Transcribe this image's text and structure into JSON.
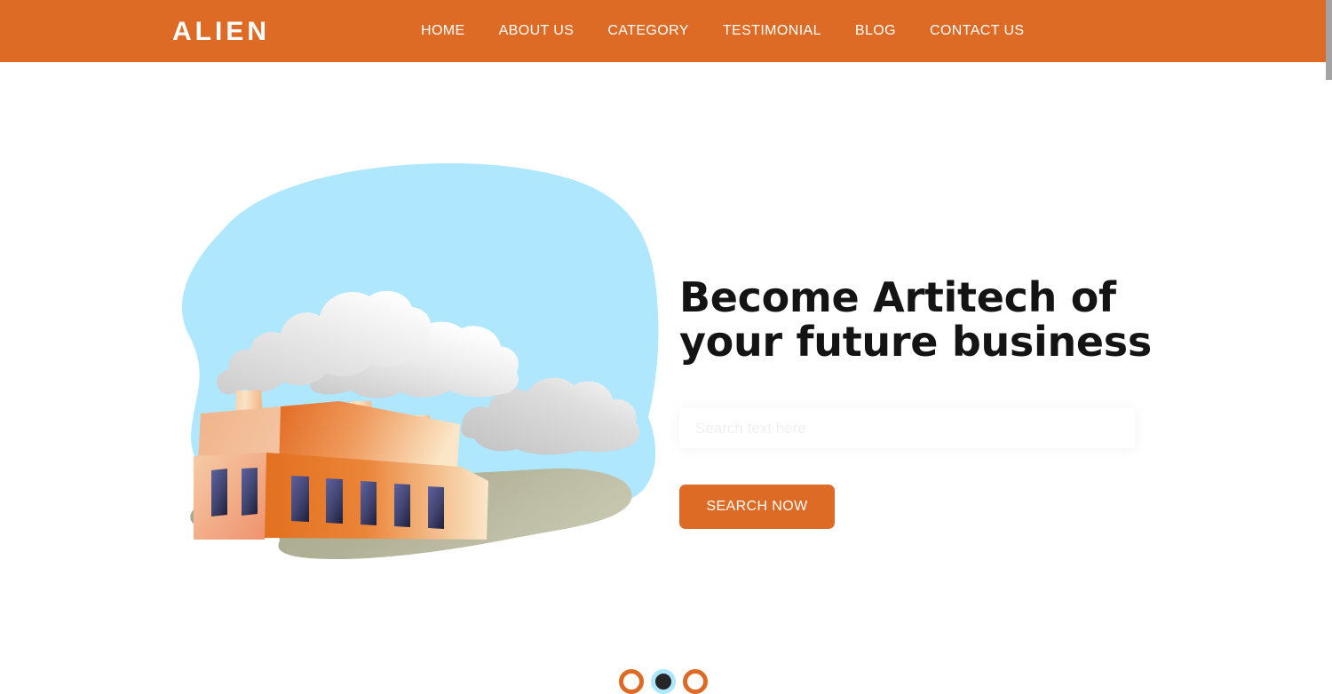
{
  "colors": {
    "brand_orange": "#DD6B26",
    "sky_blue": "#AEE7FE",
    "ground_olive": "#A8A890",
    "dot_active": "#262626",
    "heading": "#141414"
  },
  "header": {
    "brand": "ALIEN",
    "nav": [
      {
        "label": "HOME"
      },
      {
        "label": "ABOUT US"
      },
      {
        "label": "CATEGORY"
      },
      {
        "label": "TESTIMONIAL"
      },
      {
        "label": "BLOG"
      },
      {
        "label": "CONTACT US"
      }
    ]
  },
  "hero": {
    "title": "Become Artitech of\nyour future business",
    "search": {
      "value": "",
      "placeholder": "Search text here"
    },
    "cta_label": "SEARCH NOW",
    "illustration": {
      "name": "factory-illustration",
      "parts": [
        "sky-blob",
        "ground-blob",
        "smokestack-left",
        "smokestack-middle",
        "smokestack-right",
        "smoke-cloud-left",
        "smoke-cloud-middle",
        "smoke-cloud-right",
        "factory-main-building",
        "factory-side-building",
        "factory-windows"
      ]
    }
  },
  "carousel": {
    "dots": [
      {
        "name": "slide-1",
        "active": false
      },
      {
        "name": "slide-2",
        "active": true
      },
      {
        "name": "slide-3",
        "active": false
      }
    ]
  }
}
